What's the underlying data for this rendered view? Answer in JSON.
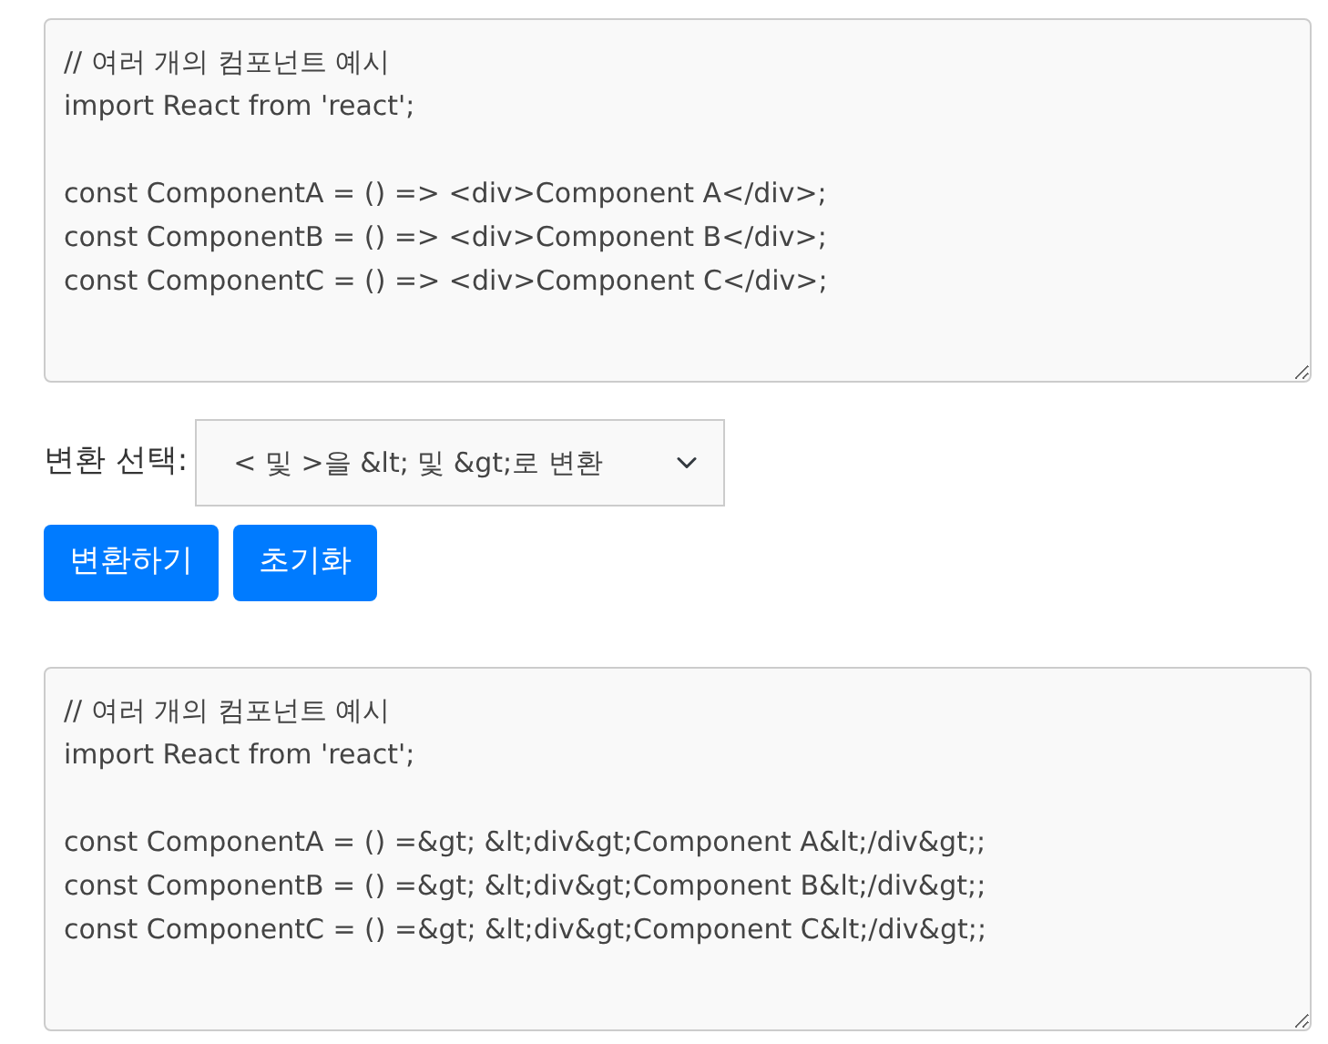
{
  "input_code": {
    "paragraphs": [
      [
        "// 여러 개의 컴포넌트 예시",
        "import React from 'react';"
      ],
      [
        "const ComponentA = () => <div>Component A</div>;",
        "const ComponentB = () => <div>Component B</div>;",
        "const ComponentC = () => <div>Component C</div>;"
      ]
    ]
  },
  "conversion": {
    "label": "변환 선택:",
    "selected_option": "< 및 >을 &lt; 및 &gt;로 변환"
  },
  "buttons": [
    "변환하기",
    "초기화"
  ],
  "output_code": {
    "paragraphs": [
      [
        "// 여러 개의 컴포넌트 예시",
        "import React from 'react';"
      ],
      [
        "const ComponentA = () =&gt; &lt;div&gt;Component A&lt;/div&gt;;",
        "const ComponentB = () =&gt; &lt;div&gt;Component B&lt;/div&gt;;",
        "const ComponentC = () =&gt; &lt;div&gt;Component C&lt;/div&gt;;"
      ]
    ]
  }
}
